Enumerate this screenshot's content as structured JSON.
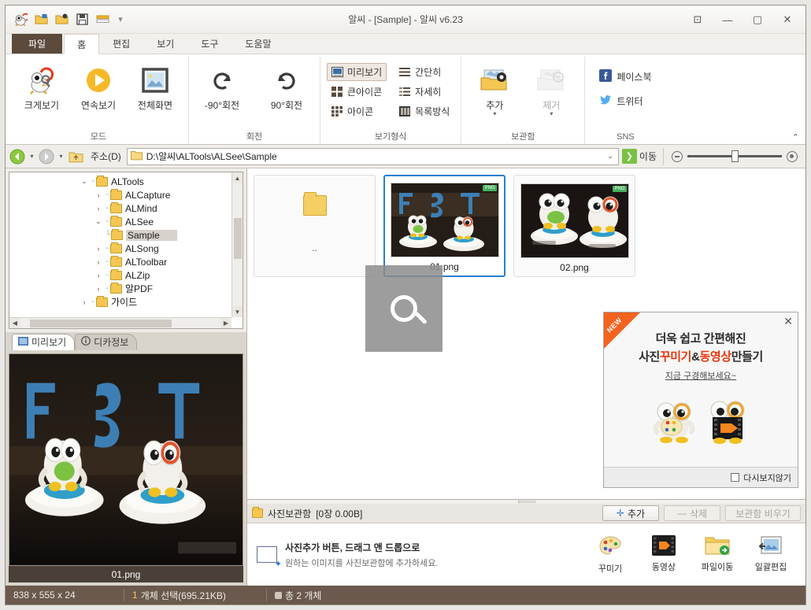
{
  "window": {
    "title": "알씨 - [Sample] - 알씨 v6.23",
    "quick_access": [
      "app-icon",
      "open-folder-icon",
      "save-as-folder-icon",
      "save-icon",
      "slideshow-icon"
    ],
    "qat_more": "▾",
    "controls": {
      "ribbon_options": "⊡",
      "minimize": "—",
      "maximize": "▢",
      "close": "✕"
    }
  },
  "tabs": [
    {
      "label": "파일",
      "kind": "file"
    },
    {
      "label": "홈",
      "kind": "active"
    },
    {
      "label": "편집",
      "kind": "normal"
    },
    {
      "label": "보기",
      "kind": "normal"
    },
    {
      "label": "도구",
      "kind": "normal"
    },
    {
      "label": "도움말",
      "kind": "normal"
    }
  ],
  "ribbon": {
    "collapse_caret": "⌃",
    "groups": [
      {
        "label": "모드",
        "buttons": [
          {
            "label": "크게보기",
            "icon": "magnify-bird-icon"
          },
          {
            "label": "연속보기",
            "icon": "play-circle-icon"
          },
          {
            "label": "전체화면",
            "icon": "fullscreen-picture-icon"
          }
        ]
      },
      {
        "label": "회전",
        "buttons": [
          {
            "label": "-90°회전",
            "icon": "rotate-left-icon"
          },
          {
            "label": "90°회전",
            "icon": "rotate-right-icon"
          }
        ]
      },
      {
        "label": "보기형식",
        "items": [
          {
            "label": "미리보기",
            "icon": "preview-icon",
            "selected": true
          },
          {
            "label": "간단히",
            "icon": "list-simple-icon",
            "selected": false
          },
          {
            "label": "큰아이콘",
            "icon": "large-icons-icon",
            "selected": false
          },
          {
            "label": "자세히",
            "icon": "list-detail-icon",
            "selected": false
          },
          {
            "label": "아이콘",
            "icon": "small-icons-icon",
            "selected": false
          },
          {
            "label": "목록방식",
            "icon": "tile-mode-icon",
            "selected": false
          }
        ]
      },
      {
        "label": "보관함",
        "buttons": [
          {
            "label": "추가",
            "icon": "basket-add-icon",
            "enabled": true
          },
          {
            "label": "제거",
            "icon": "basket-remove-icon",
            "enabled": false
          }
        ]
      },
      {
        "label": "SNS",
        "items": [
          {
            "label": "페이스북",
            "icon": "facebook-icon",
            "color": "#3b5998"
          },
          {
            "label": "트위터",
            "icon": "twitter-icon",
            "color": "#55acee"
          }
        ]
      }
    ]
  },
  "addressbar": {
    "back_title": "뒤로",
    "forward_title": "앞으로",
    "up_title": "상위 폴더",
    "label": "주소(D)",
    "path": "D:\\알씨\\ALTools\\ALSee\\Sample",
    "dropdown_caret": "⌄",
    "go_label": "이동",
    "go_glyph": "❯",
    "zoom_out": "zoom-out-icon",
    "zoom_in": "zoom-in-icon",
    "zoom_value": 47
  },
  "tree": {
    "nodes": [
      {
        "label": "ALTools",
        "indent": 1,
        "arrow": "⌄",
        "selected": false
      },
      {
        "label": "ALCapture",
        "indent": 2,
        "arrow": "›",
        "selected": false
      },
      {
        "label": "ALMind",
        "indent": 2,
        "arrow": "›",
        "selected": false
      },
      {
        "label": "ALSee",
        "indent": 2,
        "arrow": "⌄",
        "selected": false
      },
      {
        "label": "Sample",
        "indent": 3,
        "arrow": "",
        "selected": true
      },
      {
        "label": "ALSong",
        "indent": 2,
        "arrow": "›",
        "selected": false
      },
      {
        "label": "ALToolbar",
        "indent": 2,
        "arrow": "›",
        "selected": false
      },
      {
        "label": "ALZip",
        "indent": 2,
        "arrow": "›",
        "selected": false
      },
      {
        "label": "알PDF",
        "indent": 2,
        "arrow": "›",
        "selected": false
      },
      {
        "label": "가이드",
        "indent": 1,
        "arrow": "›",
        "selected": false
      }
    ]
  },
  "preview": {
    "tabs": [
      {
        "label": "미리보기",
        "icon": "preview-icon",
        "active": true
      },
      {
        "label": "디카정보",
        "icon": "info-icon",
        "active": false
      }
    ],
    "caption": "01.png"
  },
  "thumbnails": [
    {
      "name": "..",
      "type": "folder-up",
      "selected": false,
      "badge": ""
    },
    {
      "name": "01.png",
      "type": "image",
      "selected": true,
      "badge": "PNG"
    },
    {
      "name": "02.png",
      "type": "image",
      "selected": false,
      "badge": "PNG"
    }
  ],
  "overlay": {
    "icon": "search-icon"
  },
  "ad": {
    "ribbon_label": "NEW",
    "close": "✕",
    "line1": "더욱 쉽고 간편해진",
    "line2_a": "사진",
    "line2_hl1": "꾸미기",
    "line2_mid": "&",
    "line2_hl2": "동영상",
    "line2_b": "만들기",
    "subtitle": "지금 구경해보세요~",
    "footer_label": "다시보지않기"
  },
  "basket": {
    "icon": "photo-basket-icon",
    "title": "사진보관함",
    "count_text": "[0장 0.00B]",
    "buttons": [
      {
        "label": "추가",
        "glyph": "✛",
        "enabled": true
      },
      {
        "label": "삭제",
        "glyph": "—",
        "enabled": false
      },
      {
        "label": "보관함 비우기",
        "glyph": "",
        "enabled": false
      }
    ],
    "hint_title": "사진추가 버튼, 드래그 앤 드롭으로",
    "hint_sub": "원하는 이미지를 사진보관함에 추가하세요.",
    "tools": [
      {
        "label": "꾸미기",
        "icon": "palette-icon"
      },
      {
        "label": "동영상",
        "icon": "film-icon"
      },
      {
        "label": "파일이동",
        "icon": "folder-move-icon"
      },
      {
        "label": "일괄편집",
        "icon": "batch-edit-icon"
      }
    ]
  },
  "statusbar": {
    "dimensions": "838 x 555 x 24",
    "selection_count": "1",
    "selection_text": "개체 선택(695.21KB)",
    "total_text": "총 2 개체"
  }
}
